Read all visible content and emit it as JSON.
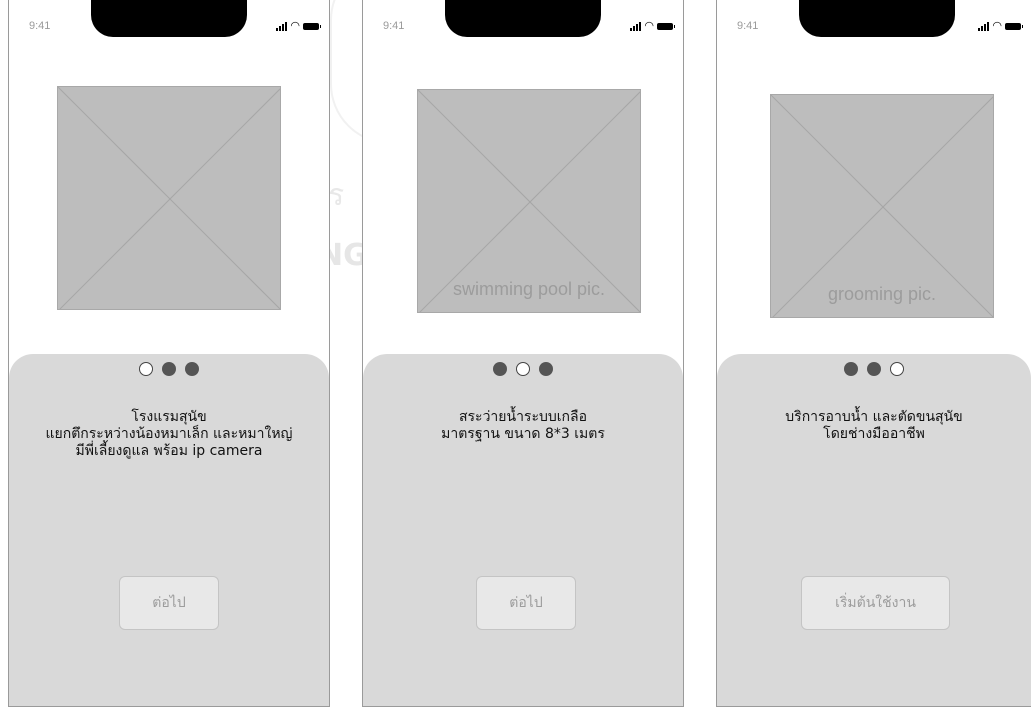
{
  "status_time": "9:41",
  "watermark": {
    "line1": "กร",
    "line2": "NG"
  },
  "screens": [
    {
      "image_caption": "",
      "pagination": [
        true,
        false,
        false
      ],
      "description": [
        "โรงแรมสุนัข",
        "แยกตึกระหว่างน้องหมาเล็ก และหมาใหญ่",
        "มีพี่เลี้ยงดูแล พร้อม ip camera"
      ],
      "button_label": "ต่อไป"
    },
    {
      "image_caption": "swimming pool pic.",
      "pagination": [
        false,
        true,
        false
      ],
      "description": [
        "สระว่ายน้ำระบบเกลือ",
        "มาตรฐาน ขนาด 8*3 เมตร"
      ],
      "button_label": "ต่อไป"
    },
    {
      "image_caption": "grooming pic.",
      "pagination": [
        false,
        false,
        true
      ],
      "description": [
        "บริการอาบน้ำ และตัดขนสุนัข",
        "โดยช่างมืออาชีพ"
      ],
      "button_label": "เริ่มต้นใช้งาน"
    }
  ]
}
